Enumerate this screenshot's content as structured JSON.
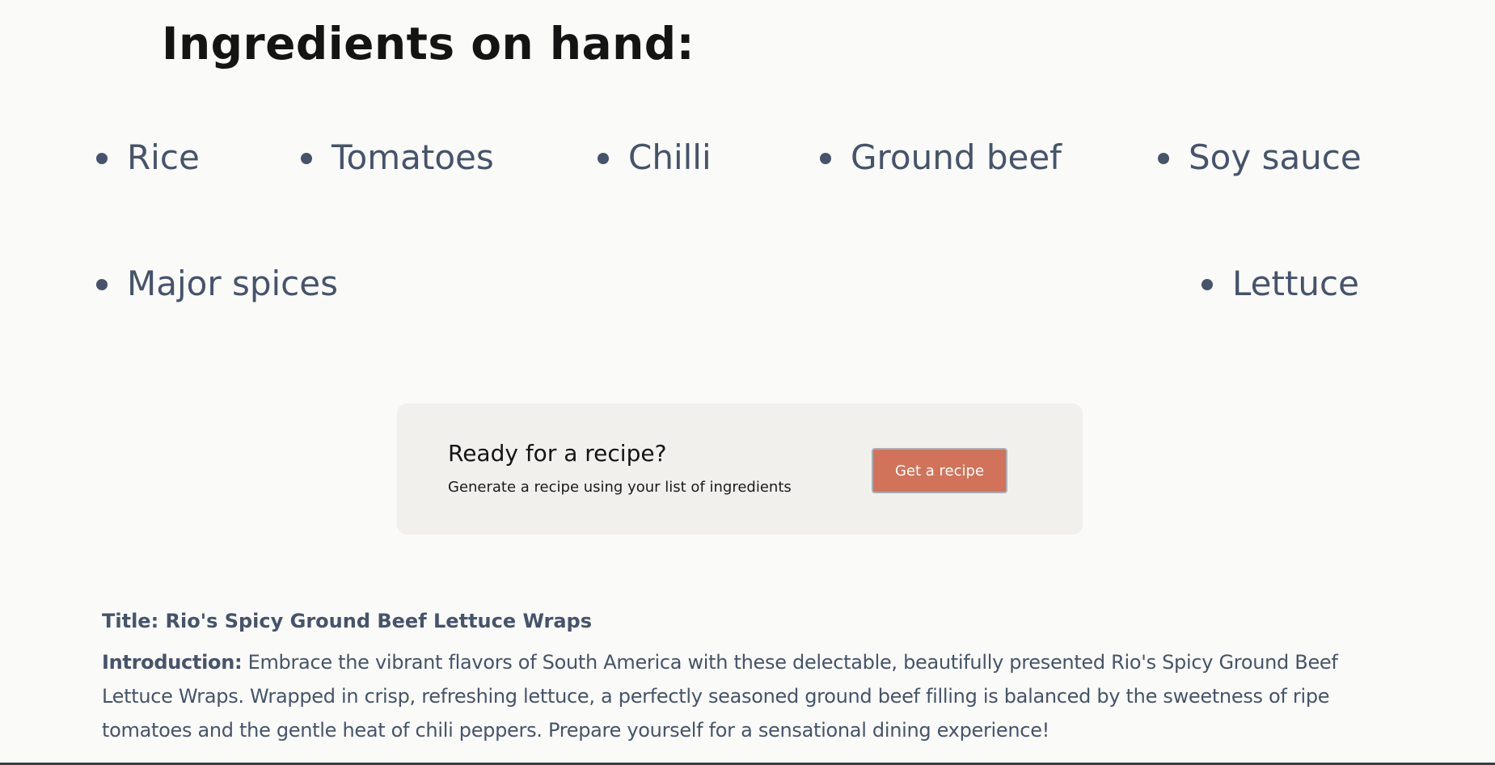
{
  "heading": "Ingredients on hand:",
  "ingredients": [
    "Rice",
    "Tomatoes",
    "Chilli",
    "Ground beef",
    "Soy sauce",
    "Major spices",
    "Lettuce"
  ],
  "cta": {
    "title": "Ready for a recipe?",
    "subtitle": "Generate a recipe using your list of ingredients",
    "button_label": "Get a recipe"
  },
  "recipe": {
    "title": "Title: Rio's Spicy Ground Beef Lettuce Wraps",
    "intro_label": "Introduction:",
    "intro_text": " Embrace the vibrant flavors of South America with these delectable, beautifully presented Rio's Spicy Ground Beef Lettuce Wraps. Wrapped in crisp, refreshing lettuce, a perfectly seasoned ground beef filling is balanced by the sweetness of ripe tomatoes and the gentle heat of chili peppers. Prepare yourself for a sensational dining experience!"
  },
  "colors": {
    "background": "#fafaf8",
    "ingredient_text": "#46536a",
    "accent_button": "#d0735a",
    "card_background": "#f1f0ed"
  }
}
